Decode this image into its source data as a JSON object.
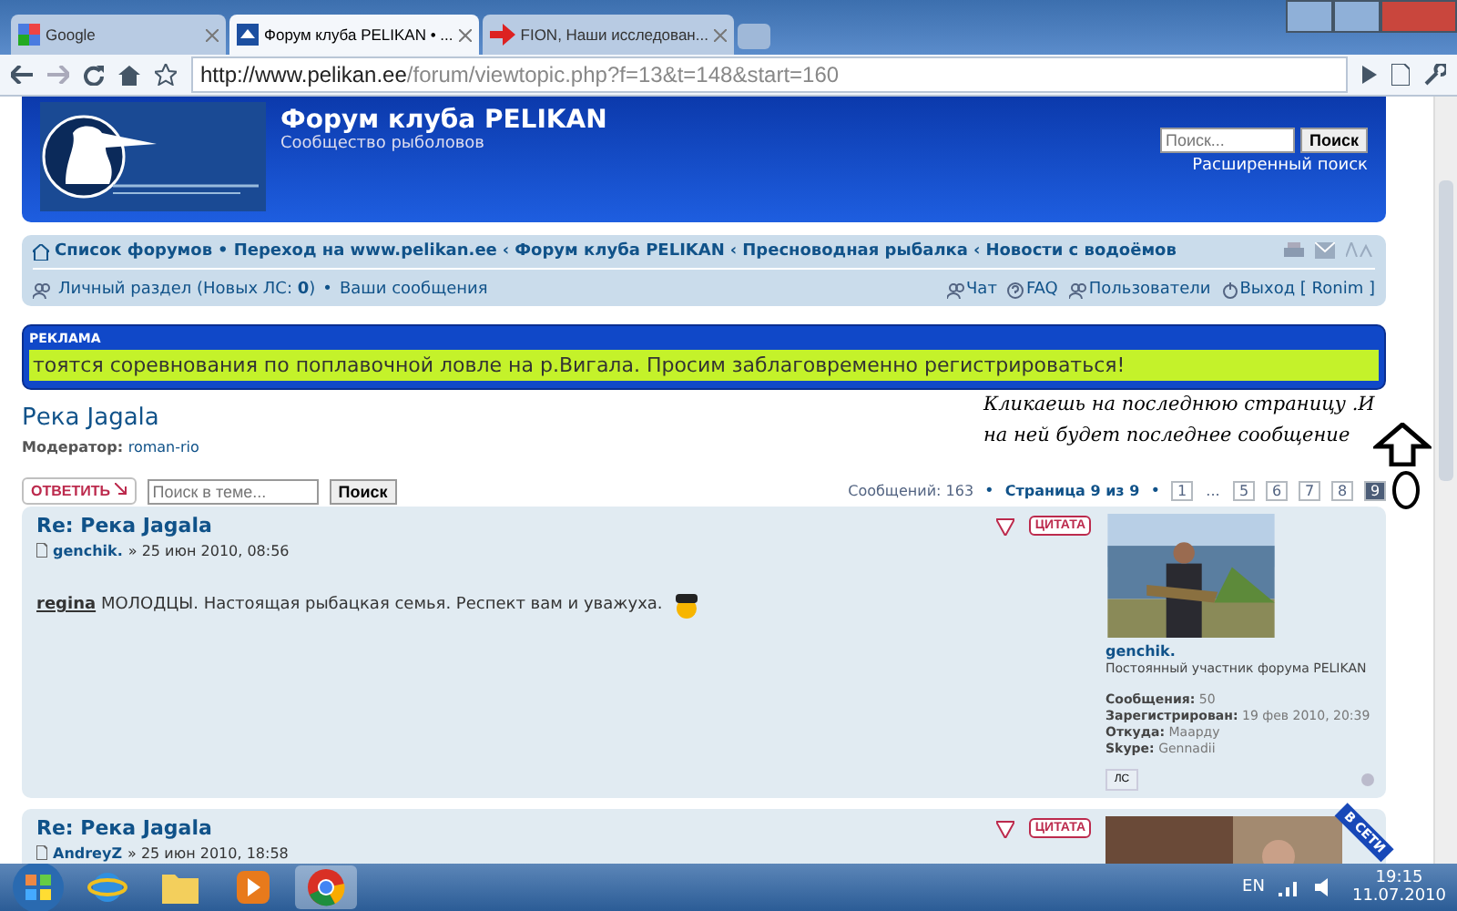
{
  "browser": {
    "tabs": [
      {
        "title": "Google",
        "selected": false,
        "kind": "google"
      },
      {
        "title": "Форум клуба PELIKAN • ...",
        "selected": true,
        "kind": "forum"
      },
      {
        "title": "FION, Наши исследован...",
        "selected": false,
        "kind": "arrow"
      }
    ],
    "url_host": "http://www.pelikan.ee",
    "url_path": "/forum/viewtopic.php?f=13&t=148&start=160"
  },
  "header": {
    "title": "Форум клуба PELIKAN",
    "subtitle": "Сообщество рыболовов",
    "search_placeholder": "Поиск...",
    "search_button": "Поиск",
    "advanced": "Расширенный поиск"
  },
  "breadcrumbs": [
    {
      "label": "Список форумов"
    },
    {
      "sep": "•",
      "label": "Переход на www.pelikan.ee"
    },
    {
      "sep": "‹",
      "label": "Форум клуба PELIKAN"
    },
    {
      "sep": "‹",
      "label": "Пресноводная рыбалка"
    },
    {
      "sep": "‹",
      "label": "Новости с водоёмов"
    }
  ],
  "userbar": {
    "left": [
      {
        "label": "Личный раздел (Новых ЛС: **0**)"
      },
      {
        "sep": "•",
        "label": "Ваши сообщения"
      }
    ],
    "right": [
      {
        "label": "Чат",
        "kind": "users"
      },
      {
        "label": "FAQ",
        "kind": "faq"
      },
      {
        "label": "Пользователи",
        "kind": "users"
      },
      {
        "label": "Выход [ Ronim ]",
        "kind": "power"
      }
    ]
  },
  "ad": {
    "label": "РЕКЛАМА",
    "text": "тоятся соревнования по поплавочной ловле на р.Вигала. Просим заблаговременно регистрироваться!"
  },
  "topic": {
    "title": "Река Jagala",
    "moderator_label": "Модератор:",
    "moderator": "roman-rio"
  },
  "actions": {
    "reply": "ОТВЕТИТЬ",
    "search_placeholder": "Поиск в теме...",
    "search_button": "Поиск",
    "count": "Сообщений: 163",
    "separator": "•",
    "page_info": "Страница 9 из 9",
    "pages": [
      {
        "label": "1",
        "selected": false
      },
      {
        "label": "...",
        "selected": false,
        "kind": "gap"
      },
      {
        "label": "5",
        "selected": false
      },
      {
        "label": "6",
        "selected": false
      },
      {
        "label": "7",
        "selected": false
      },
      {
        "label": "8",
        "selected": false
      },
      {
        "label": "9",
        "selected": true
      }
    ]
  },
  "annotation": "Кликаешь на последнюю страницу .И на ней будет последнее сообщение",
  "posts": [
    {
      "title": "Re: Река Jagala",
      "author": "genchik.",
      "date": "» 25 июн 2010, 08:56",
      "quote": "ЦИТАТА",
      "mention": "regina",
      "text": "МОЛОДЦЫ. Настоящая рыбацкая семья. Респект вам и уважуха.",
      "online": false,
      "profile": {
        "name": "genchik.",
        "rank": "Постоянный участник форума PELIKAN",
        "fields": [
          {
            "label": "Сообщения:",
            "value": "50"
          },
          {
            "label": "Зарегистрирован:",
            "value": "19 фев 2010, 20:39"
          },
          {
            "label": "Откуда:",
            "value": "Маарду"
          },
          {
            "label": "Skype:",
            "value": "Gennadii"
          }
        ],
        "pm": "ЛС"
      }
    },
    {
      "title": "Re: Река Jagala",
      "author": "AndreyZ",
      "date": "» 25 июн 2010, 18:58",
      "quote": "ЦИТАТА",
      "online": true,
      "online_label": "В СЕТИ"
    }
  ],
  "taskbar": {
    "apps": [
      {
        "kind": "ie",
        "selected": false
      },
      {
        "kind": "folder",
        "selected": false
      },
      {
        "kind": "media",
        "selected": false
      },
      {
        "kind": "chrome",
        "selected": true
      }
    ],
    "lang": "EN",
    "time": "19:15",
    "date": "11.07.2010"
  }
}
